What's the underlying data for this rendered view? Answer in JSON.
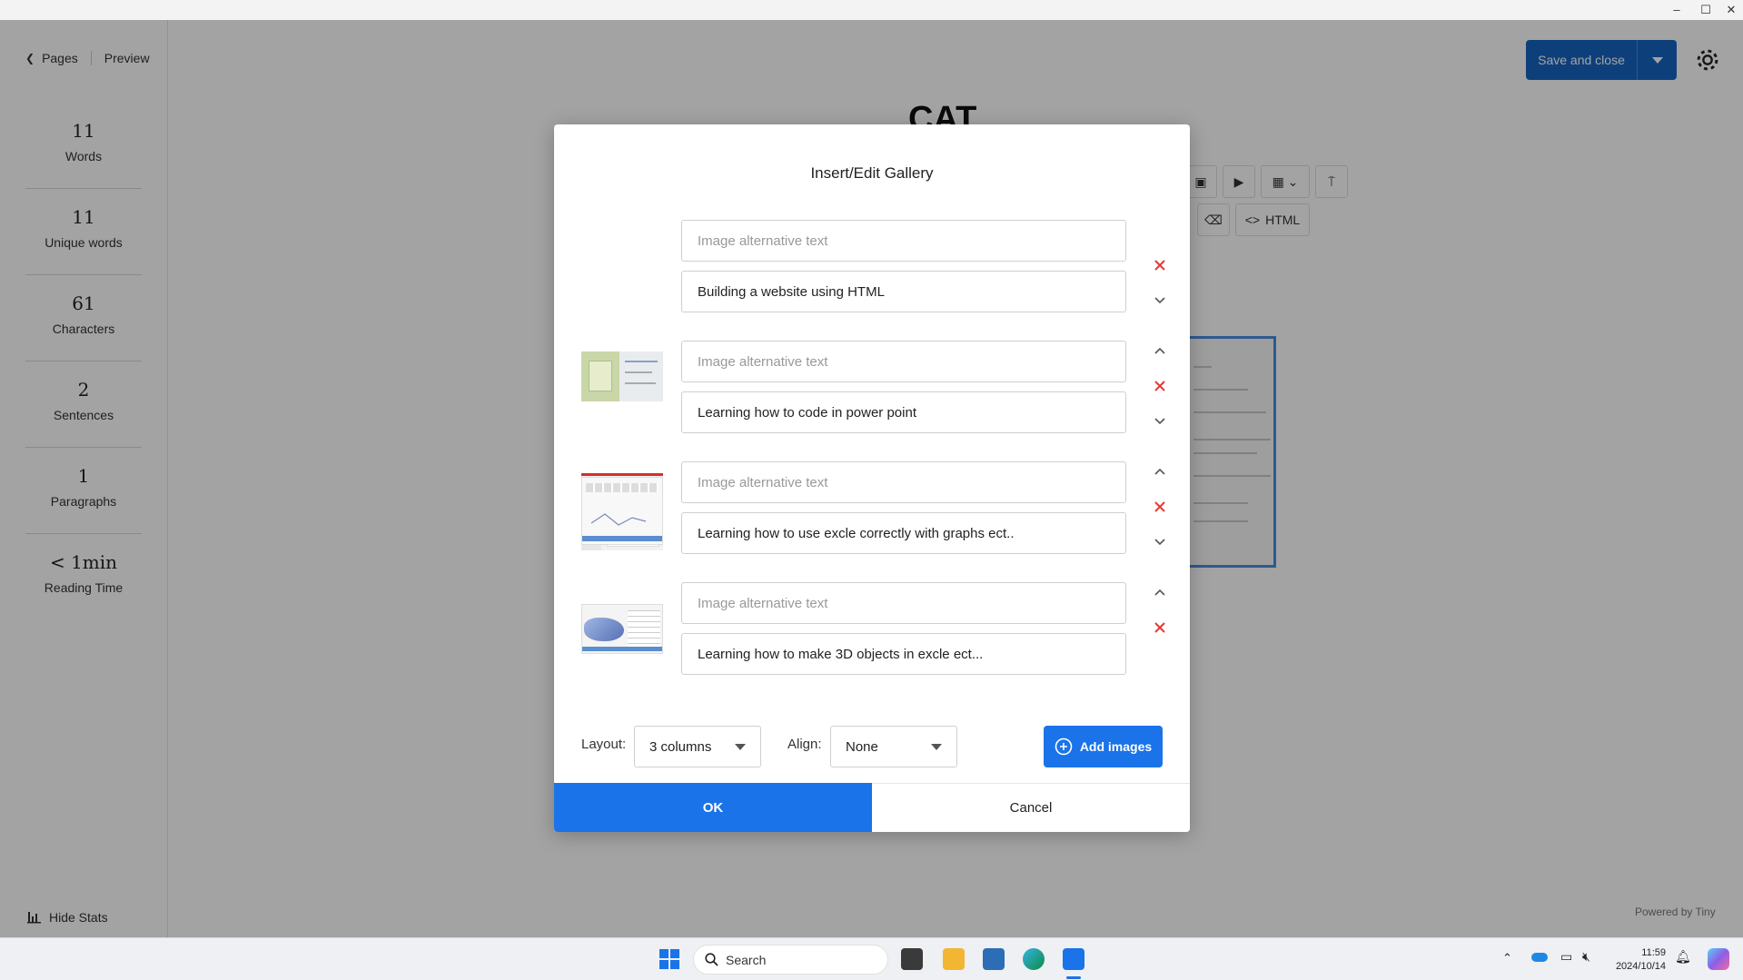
{
  "editor": {
    "nav": {
      "pages_label": "Pages",
      "preview_label": "Preview"
    },
    "stats": [
      {
        "value": "11",
        "label": "Words"
      },
      {
        "value": "11",
        "label": "Unique words"
      },
      {
        "value": "61",
        "label": "Characters"
      },
      {
        "value": "2",
        "label": "Sentences"
      },
      {
        "value": "1",
        "label": "Paragraphs"
      },
      {
        "value": "< 1min",
        "label": "Reading Time"
      }
    ],
    "hide_stats_label": "Hide Stats",
    "doc_title": "CAT",
    "toolbar_html_label": "HTML",
    "save_label": "Save and close",
    "powered_by": "Powered by Tiny"
  },
  "dialog": {
    "title": "Insert/Edit Gallery",
    "images": [
      {
        "alt_placeholder": "Image alternative text",
        "alt_value": "",
        "caption": "Building a website using HTML"
      },
      {
        "alt_placeholder": "Image alternative text",
        "alt_value": "",
        "caption": "Learning how to code in power point"
      },
      {
        "alt_placeholder": "Image alternative text",
        "alt_value": "",
        "caption": "Learning how to use excle correctly with graphs ect.."
      },
      {
        "alt_placeholder": "Image alternative text",
        "alt_value": "",
        "caption": "Learning how to make 3D objects in excle ect..."
      }
    ],
    "layout_label": "Layout:",
    "layout_value": "3 columns",
    "align_label": "Align:",
    "align_value": "None",
    "add_images_label": "Add images",
    "ok_label": "OK",
    "cancel_label": "Cancel"
  },
  "taskbar": {
    "search_label": "Search",
    "time": "11:59",
    "date": "2024/10/14"
  },
  "colors": {
    "accent": "#1a73e8",
    "save_button": "#1565c0",
    "remove_icon": "#e53935"
  }
}
